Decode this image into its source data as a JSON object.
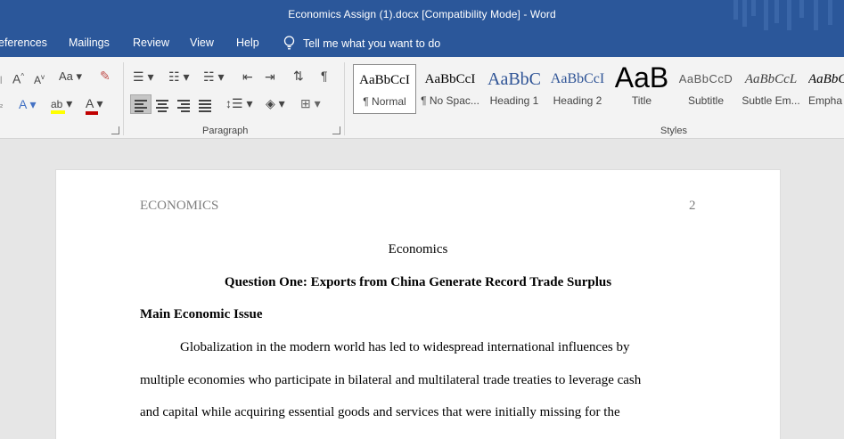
{
  "window": {
    "title": "Economics Assign (1).docx [Compatibility Mode]  -  Word"
  },
  "menu": {
    "tabs": [
      "eferences",
      "Mailings",
      "Review",
      "View",
      "Help"
    ],
    "tell_me": "Tell me what you want to do"
  },
  "ribbon": {
    "font_group": {
      "grow_font": "A",
      "shrink_font": "A",
      "change_case": "Aa",
      "text_effects": "A",
      "font_color": "A"
    },
    "paragraph_label": "Paragraph",
    "styles_label": "Styles",
    "styles": [
      {
        "preview": "AaBbCcI",
        "name": "¶ Normal"
      },
      {
        "preview": "AaBbCcI",
        "name": "¶ No Spac..."
      },
      {
        "preview": "AaBbC",
        "name": "Heading 1"
      },
      {
        "preview": "AaBbCcI",
        "name": "Heading 2"
      },
      {
        "preview": "AaB",
        "name": "Title"
      },
      {
        "preview": "AaBbCcD",
        "name": "Subtitle"
      },
      {
        "preview": "AaBbCcL",
        "name": "Subtle Em..."
      },
      {
        "preview": "AaBbC",
        "name": "Empha"
      }
    ],
    "colors": {
      "highlight": "#ffff00",
      "font_color": "#c00000"
    }
  },
  "document": {
    "header_left": "ECONOMICS",
    "header_page": "2",
    "title": "Economics",
    "question_heading": "Question One: Exports from China Generate Record Trade Surplus",
    "section_heading": "Main Economic Issue",
    "lines": [
      "Globalization in the modern world has led to widespread international influences by",
      "multiple economies who participate in bilateral and multilateral trade treaties to leverage cash",
      "and capital while acquiring essential goods and services that were initially missing for the"
    ]
  }
}
